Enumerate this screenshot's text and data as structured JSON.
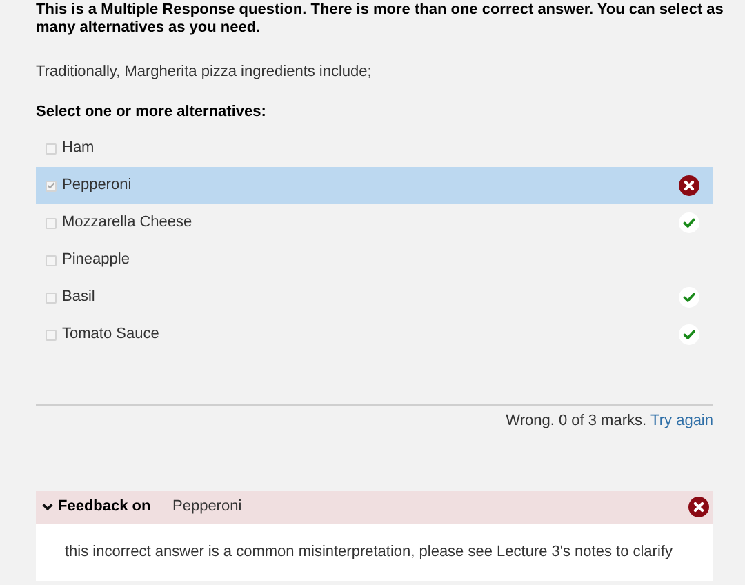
{
  "instructions": "This is a Multiple Response question. There is more than one correct answer.  You can select as many alternatives as you need.",
  "question": "Traditionally, Margherita pizza ingredients include;",
  "prompt": "Select one or more alternatives:",
  "options": [
    {
      "label": "Ham",
      "checked": false,
      "selected": false,
      "kind": "plain"
    },
    {
      "label": "Pepperoni",
      "checked": true,
      "selected": true,
      "kind": "wrong"
    },
    {
      "label": "Mozzarella Cheese",
      "checked": false,
      "selected": false,
      "kind": "correct"
    },
    {
      "label": "Pineapple",
      "checked": false,
      "selected": false,
      "kind": "plain"
    },
    {
      "label": "Basil",
      "checked": false,
      "selected": false,
      "kind": "correct"
    },
    {
      "label": "Tomato Sauce",
      "checked": false,
      "selected": false,
      "kind": "correct"
    }
  ],
  "score": "Wrong. 0 of 3 marks.",
  "retry_link": "Try again",
  "feedback": {
    "title": "Feedback on",
    "option": "Pepperoni",
    "expanded": true,
    "kind": "wrong",
    "text": "this incorrect answer is a common misinterpretation, please see Lecture 3's notes to clarify"
  }
}
